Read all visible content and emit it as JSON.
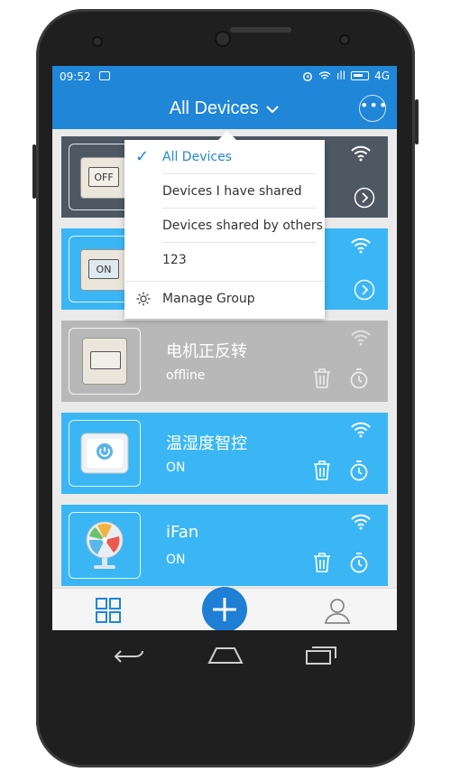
{
  "status_bar": {
    "time": "09:52",
    "network": "4G",
    "signal_label": "ıll"
  },
  "header": {
    "title": "All Devices",
    "more_label": "•••"
  },
  "dropdown": {
    "items": [
      {
        "label": "All Devices",
        "selected": true
      },
      {
        "label": "Devices I have shared"
      },
      {
        "label": "Devices shared by others"
      },
      {
        "label": "123"
      },
      {
        "label": "Manage Group"
      }
    ]
  },
  "devices": [
    {
      "switch_text": "OFF",
      "bg": "#4d5863"
    },
    {
      "switch_text": "ON",
      "bg": "#3ab6f4"
    },
    {
      "name": "电机正反转",
      "status": "offline",
      "bg": "#b8b8b8"
    },
    {
      "name": "温湿度智控",
      "status": "ON",
      "bg": "#3ab6f4"
    },
    {
      "name": "iFan",
      "status": "ON",
      "bg": "#3ab6f4"
    }
  ],
  "colors": {
    "accent": "#1f86d8",
    "card_blue": "#3ab6f4",
    "card_dark": "#4d5863",
    "card_offline": "#b8b8b8"
  },
  "icons": [
    "image-icon",
    "alarm-icon",
    "wifi-icon",
    "signal-icon",
    "battery-icon",
    "chevron-down-icon",
    "more-icon",
    "check-icon",
    "gear-icon",
    "trash-icon",
    "timer-icon",
    "chevron-right-icon",
    "grid-icon",
    "plus-icon",
    "user-icon",
    "back-icon",
    "home-icon",
    "recents-icon"
  ]
}
